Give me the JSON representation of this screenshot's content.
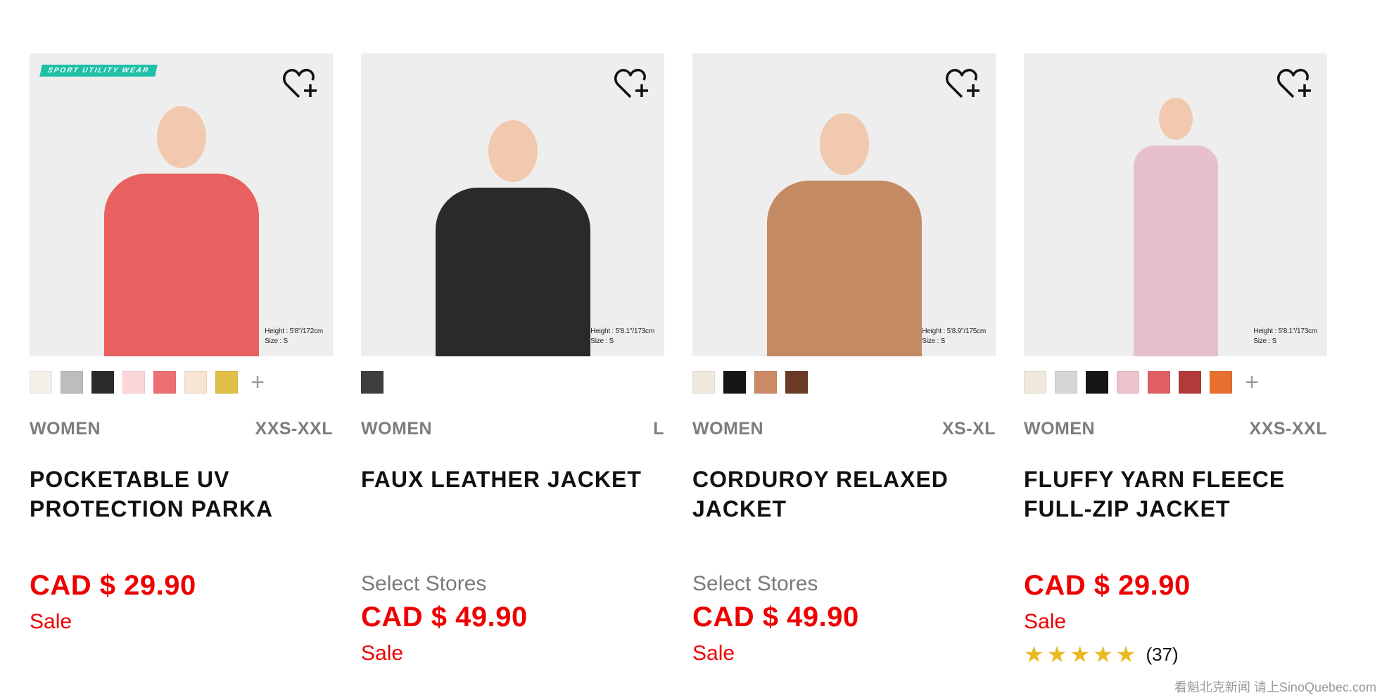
{
  "products": [
    {
      "tag": "SPORT UTILITY WEAR",
      "model_height": "Height : 5'8\"/172cm",
      "model_size": "Size : S",
      "swatches": [
        "#f3efe9",
        "#bdbdbd",
        "#2b2b2b",
        "#fbd7d9",
        "#ec7073",
        "#f7e4d2",
        "#e0c048"
      ],
      "more_colors": "+",
      "gender": "WOMEN",
      "sizes": "XXS-XXL",
      "name": "POCKETABLE UV PROTECTION PARKA",
      "stores": "",
      "price": "CAD $ 29.90",
      "sale": "Sale",
      "garment_color": "#e8605f",
      "inner_color": "#a9a9a9",
      "hair_color": "#c07a55"
    },
    {
      "tag": "",
      "model_height": "Height : 5'8.1\"/173cm",
      "model_size": "Size : S",
      "swatches": [
        "#3e3e3e"
      ],
      "more_colors": "",
      "gender": "WOMEN",
      "sizes": "L",
      "name": "FAUX LEATHER JACKET",
      "stores": "Select Stores",
      "price": "CAD $ 49.90",
      "sale": "Sale",
      "garment_color": "#2a2a2a",
      "inner_color": "#2e6aa8",
      "hair_color": "#5b3424"
    },
    {
      "tag": "",
      "model_height": "Height : 5'8.9\"/175cm",
      "model_size": "Size : S",
      "swatches": [
        "#efe8dc",
        "#161616",
        "#c98a65",
        "#6a3a26"
      ],
      "more_colors": "",
      "gender": "WOMEN",
      "sizes": "XS-XL",
      "name": "CORDUROY RELAXED JACKET",
      "stores": "Select Stores",
      "price": "CAD $ 49.90",
      "sale": "Sale",
      "garment_color": "#c48a63",
      "inner_color": "#6a1c1c",
      "hair_color": "#4a2a1e"
    },
    {
      "tag": "",
      "model_height": "Height : 5'8.1\"/173cm",
      "model_size": "Size : S",
      "swatches": [
        "#efe8dc",
        "#d6d6d6",
        "#161616",
        "#edc3cd",
        "#df5f62",
        "#b23a3a",
        "#e8702e"
      ],
      "more_colors": "+",
      "gender": "WOMEN",
      "sizes": "XXS-XXL",
      "name": "FLUFFY YARN FLEECE FULL-ZIP JACKET",
      "stores": "",
      "price": "CAD $ 29.90",
      "sale": "Sale",
      "rating_stars": "★★★★★",
      "rating_value": 4.5,
      "reviews": "(37)",
      "garment_color": "#e6c1cc",
      "inner_color": "#1e2434",
      "hair_color": "#4a2a1e"
    }
  ],
  "watermark": "看魁北克新闻 请上SinoQuebec.com",
  "colors": {
    "sale_red": "#ee0000",
    "meta_gray": "#7d7d7d",
    "star_gold": "#e8b923"
  },
  "icons": {
    "favorite": "heart-plus-icon",
    "more_colors": "plus-icon",
    "star": "star-icon"
  }
}
